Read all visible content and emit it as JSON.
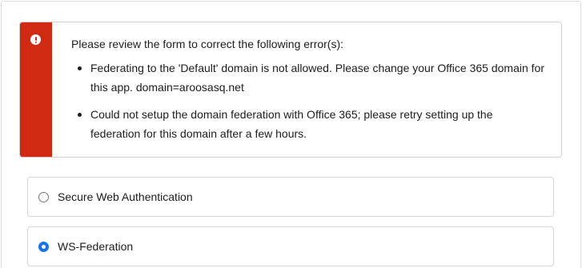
{
  "error_panel": {
    "heading": "Please review the form to correct the following error(s):",
    "errors": [
      "Federating to the 'Default' domain is not allowed. Please change your Office 365 domain for this app. domain=aroosasq.net",
      "Could not setup the domain federation with Office 365; please retry setting up the federation for this domain after a few hours."
    ],
    "icon": "exclamation-circle-icon",
    "accent_color": "#d12a12"
  },
  "auth_options": {
    "selected_index": 1,
    "items": [
      {
        "label": "Secure Web Authentication",
        "checked": false
      },
      {
        "label": "WS-Federation",
        "checked": true
      }
    ],
    "radio_color": "#1a73e8"
  }
}
